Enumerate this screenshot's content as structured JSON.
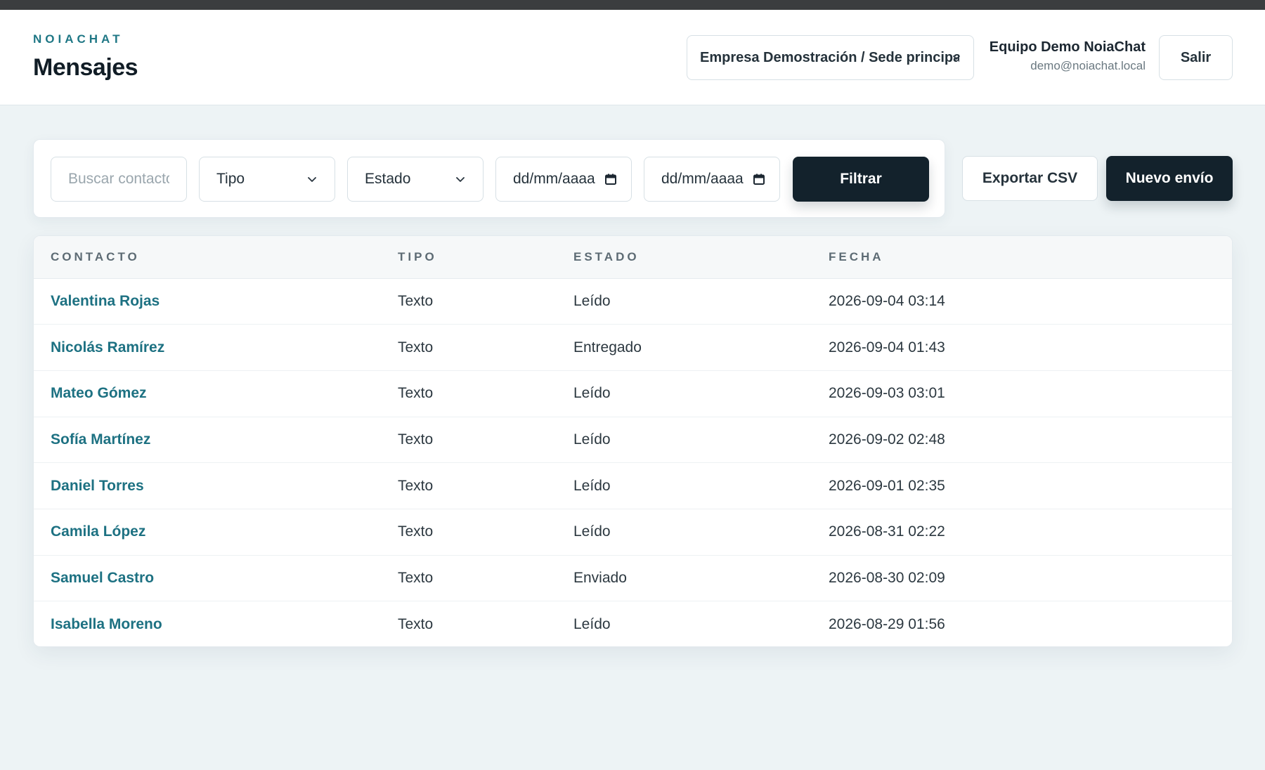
{
  "app": {
    "brand": "NOIACHAT",
    "page_title": "Mensajes"
  },
  "header": {
    "org_select_value": "Empresa Demostración / Sede principal",
    "user_name": "Equipo Demo NoiaChat",
    "user_email": "demo@noiachat.local",
    "logout_label": "Salir"
  },
  "filters": {
    "search_placeholder": "Buscar contacto",
    "tipo_value": "Tipo",
    "estado_value": "Estado",
    "date_from_placeholder": "dd/mm/aaaa",
    "date_to_placeholder": "dd/mm/aaaa",
    "filter_label": "Filtrar"
  },
  "actions": {
    "export_label": "Exportar CSV",
    "new_label": "Nuevo envío"
  },
  "table": {
    "columns": [
      "CONTACTO",
      "TIPO",
      "ESTADO",
      "FECHA"
    ],
    "rows": [
      {
        "contact": "Valentina Rojas",
        "type": "Texto",
        "status": "Leído",
        "date": "2026-09-04 03:14"
      },
      {
        "contact": "Nicolás Ramírez",
        "type": "Texto",
        "status": "Entregado",
        "date": "2026-09-04 01:43"
      },
      {
        "contact": "Mateo Gómez",
        "type": "Texto",
        "status": "Leído",
        "date": "2026-09-03 03:01"
      },
      {
        "contact": "Sofía Martínez",
        "type": "Texto",
        "status": "Leído",
        "date": "2026-09-02 02:48"
      },
      {
        "contact": "Daniel Torres",
        "type": "Texto",
        "status": "Leído",
        "date": "2026-09-01 02:35"
      },
      {
        "contact": "Camila López",
        "type": "Texto",
        "status": "Leído",
        "date": "2026-08-31 02:22"
      },
      {
        "contact": "Samuel Castro",
        "type": "Texto",
        "status": "Enviado",
        "date": "2026-08-30 02:09"
      },
      {
        "contact": "Isabella Moreno",
        "type": "Texto",
        "status": "Leído",
        "date": "2026-08-29 01:56"
      }
    ]
  },
  "icons": {
    "select_chevron": "chevron-down-icon",
    "date_picker": "calendar-icon"
  },
  "colors": {
    "brand": "#1f7785",
    "primary_button": "#13222c",
    "link": "#1d7182",
    "background": "#edf3f5"
  }
}
